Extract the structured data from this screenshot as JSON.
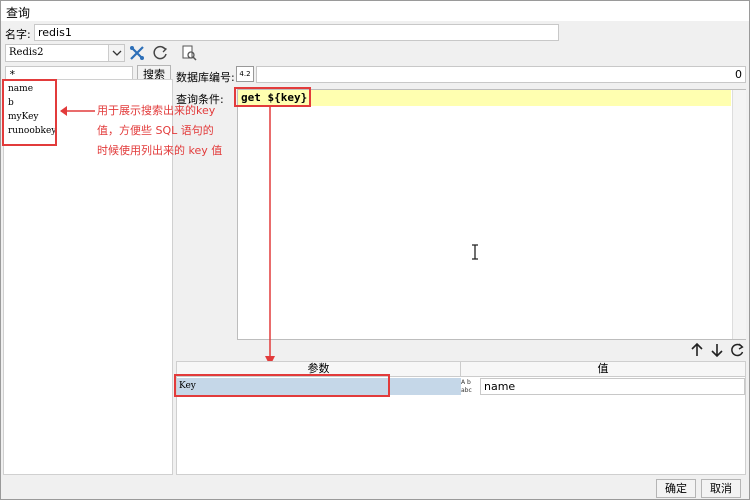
{
  "window": {
    "title": "查询"
  },
  "name_label": "名字:",
  "name_value": "redis1",
  "connection": {
    "selected": "Redis2"
  },
  "filter": {
    "value": "*",
    "search_label": "搜索"
  },
  "keys": [
    "name",
    "b",
    "myKey",
    "runoobkey"
  ],
  "annotation": [
    "用于展示搜索出来的key",
    "值，方便些 SQL 语句的",
    "时候使用列出来的 key 值"
  ],
  "db": {
    "label": "数据库编号:",
    "value": "0"
  },
  "query": {
    "label": "查询条件:",
    "text": "get ${key}"
  },
  "params": {
    "headers": {
      "param": "参数",
      "value": "值"
    },
    "row": {
      "key": "Key",
      "value": "name"
    }
  },
  "footer": {
    "ok": "确定",
    "cancel": "取消"
  },
  "colors": {
    "accent_red": "#e23b3b",
    "highlight_yellow": "#ffffb0",
    "selected_row": "#c5d7e8"
  }
}
